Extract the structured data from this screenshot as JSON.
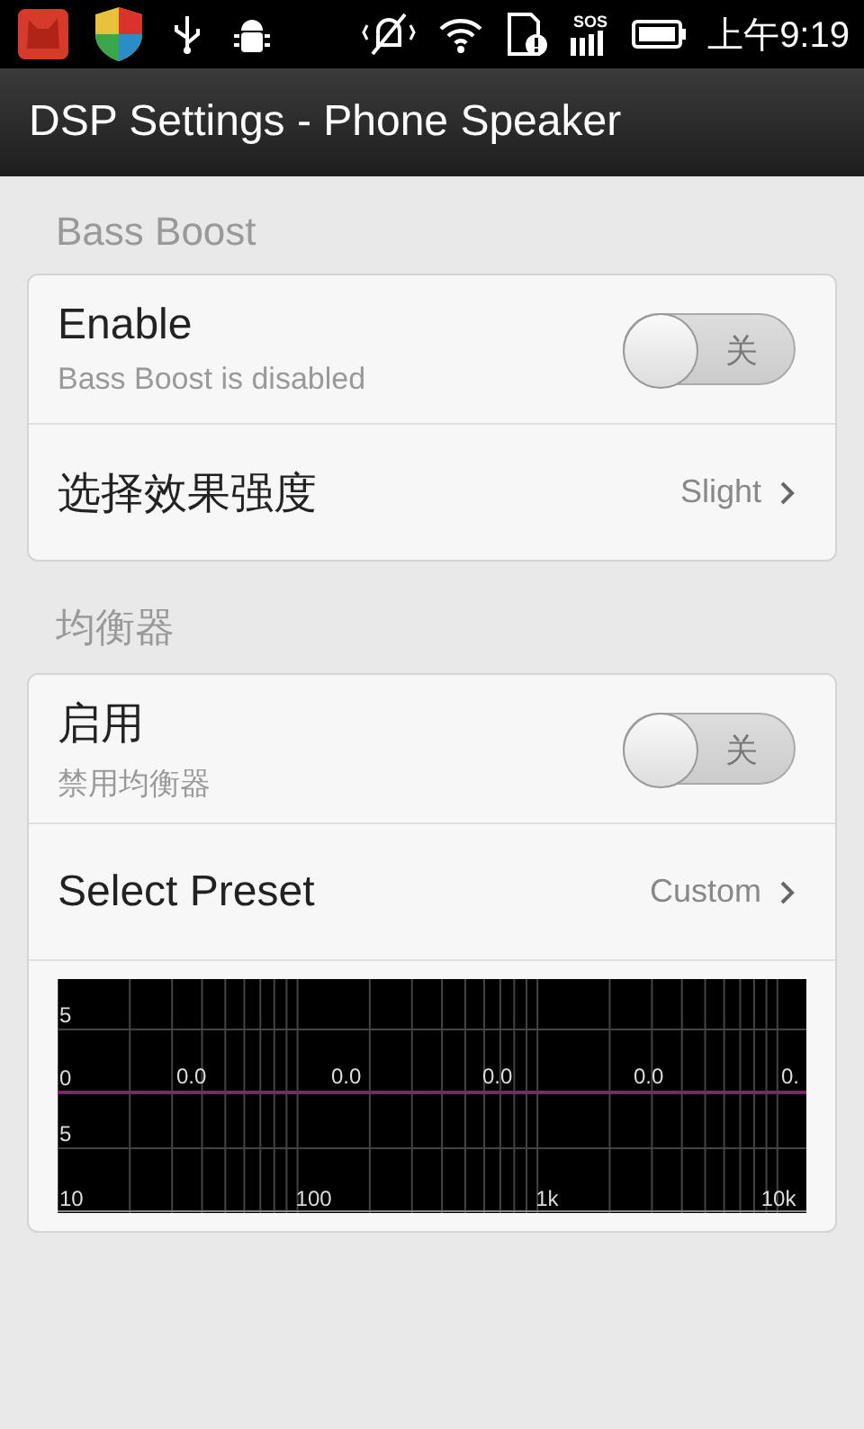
{
  "status_bar": {
    "signal_label": "SOS",
    "time": "上午9:19"
  },
  "title_bar": {
    "title": "DSP Settings - Phone Speaker"
  },
  "sections": [
    {
      "header": "Bass Boost",
      "rows": [
        {
          "kind": "toggle",
          "title": "Enable",
          "summary": "Bass Boost is disabled",
          "on": false,
          "switch_label": "关"
        },
        {
          "kind": "choice",
          "title": "选择效果强度",
          "value": "Slight"
        }
      ]
    },
    {
      "header": "均衡器",
      "rows": [
        {
          "kind": "toggle",
          "title": "启用",
          "summary": "禁用均衡器",
          "on": false,
          "switch_label": "关"
        },
        {
          "kind": "choice",
          "title": "Select Preset",
          "value": "Custom"
        },
        {
          "kind": "graph",
          "y_labels": [
            "5",
            "0",
            "5"
          ],
          "x_labels": [
            "10",
            "100",
            "1k",
            "10k"
          ],
          "band_values": [
            "0.0",
            "0.0",
            "0.0",
            "0.0",
            "0."
          ]
        }
      ]
    }
  ]
}
